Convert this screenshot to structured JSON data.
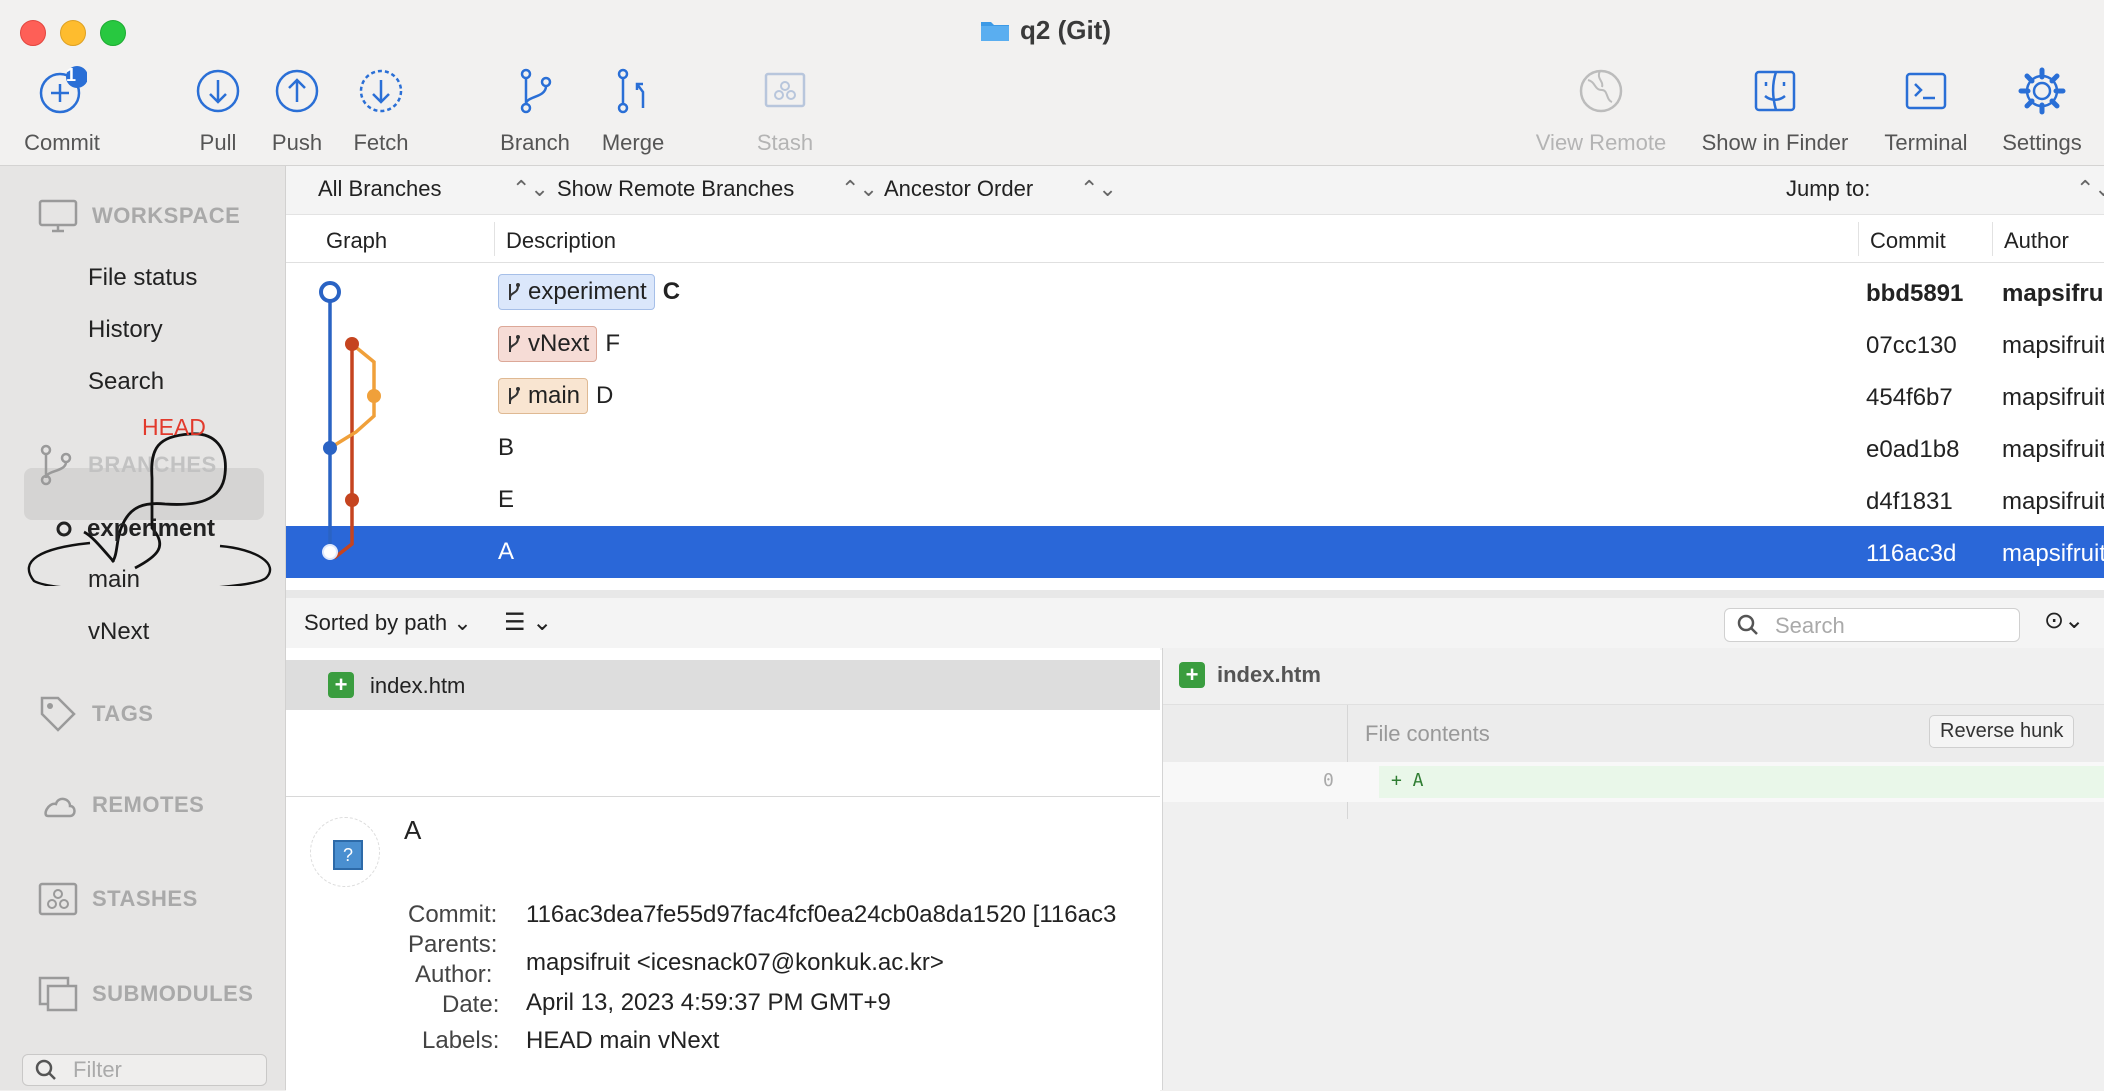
{
  "window": {
    "title": "q2 (Git)"
  },
  "toolbar": {
    "commit": "Commit",
    "commit_badge": "1",
    "pull": "Pull",
    "push": "Push",
    "fetch": "Fetch",
    "branch": "Branch",
    "merge": "Merge",
    "stash": "Stash",
    "view_remote": "View Remote",
    "show_in_finder": "Show in Finder",
    "terminal": "Terminal",
    "settings": "Settings"
  },
  "sidebar": {
    "workspace": "WORKSPACE",
    "file_status": "File status",
    "history": "History",
    "search": "Search",
    "branches": "BRANCHES",
    "branch_items": [
      "experiment",
      "main",
      "vNext"
    ],
    "tags": "TAGS",
    "remotes": "REMOTES",
    "stashes": "STASHES",
    "submodules": "SUBMODULES",
    "filter_placeholder": "Filter",
    "annotation": "HEAD"
  },
  "filters": {
    "branches": "All Branches",
    "remote": "Show Remote Branches",
    "order": "Ancestor Order",
    "jump": "Jump to:"
  },
  "columns": {
    "graph": "Graph",
    "description": "Description",
    "commit": "Commit",
    "author": "Author"
  },
  "commits": [
    {
      "tag": "experiment",
      "desc": "C",
      "hash": "bbd5891",
      "author": "mapsifruit"
    },
    {
      "tag": "vNext",
      "desc": "F",
      "hash": "07cc130",
      "author": "mapsifruit"
    },
    {
      "tag": "main",
      "desc": "D",
      "hash": "454f6b7",
      "author": "mapsifruit"
    },
    {
      "tag": "",
      "desc": "B",
      "hash": "e0ad1b8",
      "author": "mapsifruit"
    },
    {
      "tag": "",
      "desc": "E",
      "hash": "d4f1831",
      "author": "mapsifruit"
    },
    {
      "tag": "",
      "desc": "A",
      "hash": "116ac3d",
      "author": "mapsifruit"
    }
  ],
  "lower": {
    "sort": "Sorted by path",
    "search_placeholder": "Search",
    "file": "index.htm",
    "diff_file": "index.htm",
    "file_contents": "File contents",
    "reverse_hunk": "Reverse hunk",
    "line_no": "0",
    "line_text": "+ A"
  },
  "commit_detail": {
    "subject": "A",
    "commit_label": "Commit:",
    "commit_value": "116ac3dea7fe55d97fac4fcf0ea24cb0a8da1520 [116ac3",
    "parents_label": "Parents:",
    "author_label": "Author:",
    "author_value": "mapsifruit <icesnack07@konkuk.ac.kr>",
    "date_label": "Date:",
    "date_value": "April 13, 2023 4:59:37 PM GMT+9",
    "labels_label": "Labels:",
    "labels_value": "HEAD main vNext"
  },
  "colors": {
    "accent": "#2a67d8",
    "experiment": "#2a63c4",
    "vnext": "#c5441f",
    "main": "#f0a03a"
  }
}
